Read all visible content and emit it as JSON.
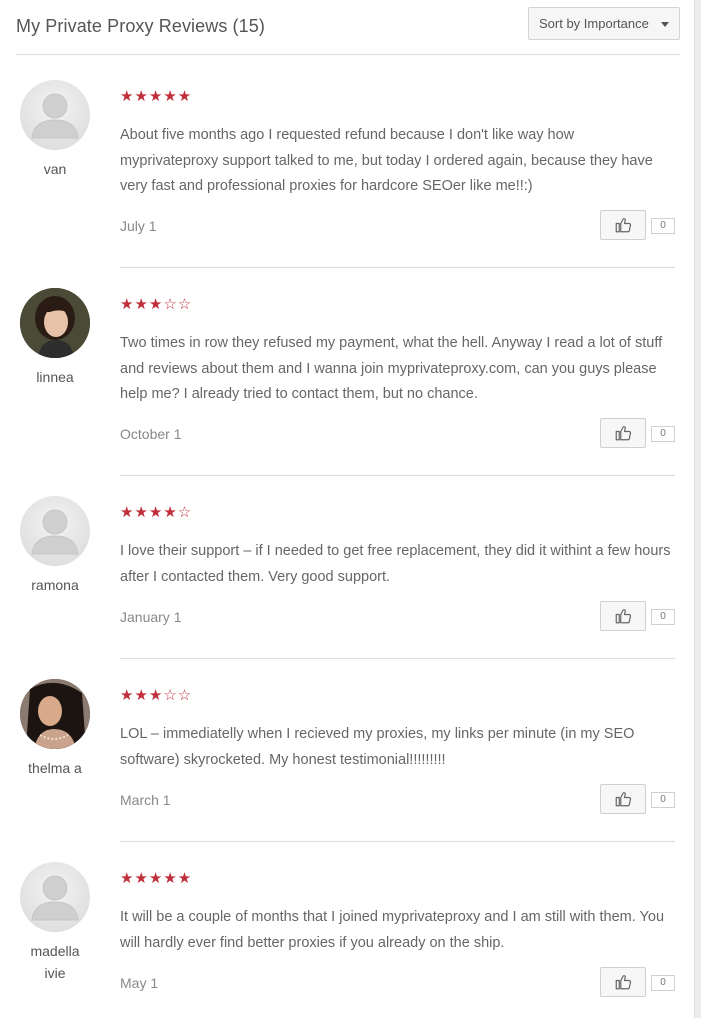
{
  "header": {
    "title": "My Private Proxy Reviews (15)",
    "sort_label": "Sort by Importance"
  },
  "reviews": [
    {
      "user": "van",
      "avatar": "default",
      "rating": 5,
      "text": "About five months ago I requested refund because I don't like way how myprivateproxy support talked to me, but today I ordered again, because they have very fast and professional proxies for hardcore SEOer like me!!:)",
      "date": "July 1",
      "likes": "0"
    },
    {
      "user": "linnea",
      "avatar": "photo",
      "rating": 3,
      "text": "Two times in row they refused my payment, what the hell. Anyway I read a lot of stuff and reviews about them and I wanna join myprivateproxy.com, can you guys please help me? I already tried to contact them, but no chance.",
      "date": "October 1",
      "likes": "0"
    },
    {
      "user": "ramona",
      "avatar": "default",
      "rating": 4,
      "text": "I love their support – if I needed to get free replacement, they did it withint a few hours after I contacted them. Very good support.",
      "date": "January 1",
      "likes": "0"
    },
    {
      "user": "thelma a",
      "avatar": "photo",
      "rating": 3,
      "text": "LOL – immediatelly when I recieved my proxies, my links per minute (in my SEO software) skyrocketed. My honest testimonial!!!!!!!!!",
      "date": "March 1",
      "likes": "0"
    },
    {
      "user": "madella ivie",
      "avatar": "default",
      "rating": 5,
      "text": "It will be a couple of months that I joined myprivateproxy and I am still with them. You will hardly ever find better proxies if you already on the ship.",
      "date": "May 1",
      "likes": "0"
    }
  ],
  "colors": {
    "star": "#c0303c",
    "divider": "#dcdcdc"
  },
  "icons": {
    "like": "thumbs-up-icon",
    "sort": "caret-down-icon",
    "star": "star-icon"
  }
}
